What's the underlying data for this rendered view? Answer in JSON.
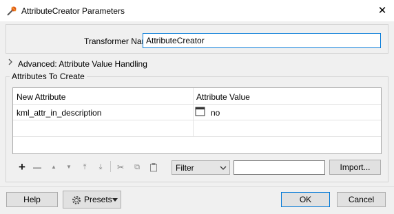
{
  "window": {
    "title": "AttributeCreator Parameters",
    "close_glyph": "✕",
    "icon": "attribute-creator-icon"
  },
  "form": {
    "transformer_name_label": "Transformer Name:",
    "transformer_name_value": "AttributeCreator",
    "advanced_label": "Advanced: Attribute Value Handling"
  },
  "attributes": {
    "group_label": "Attributes To Create",
    "columns": [
      "New Attribute",
      "Attribute Value"
    ],
    "rows": [
      {
        "name": "kml_attr_in_description",
        "value": "no",
        "value_icon": "text-editor-icon"
      }
    ]
  },
  "toolbar": {
    "add": "+",
    "remove": "—",
    "move_up": "▲",
    "move_down": "▼",
    "move_top": "⤒",
    "move_bottom": "⤓",
    "cut": "✂",
    "copy": "⧉",
    "paste": "📋",
    "filter_selected": "Filter",
    "filter_text": "",
    "import_label": "Import..."
  },
  "footer": {
    "help_label": "Help",
    "presets_label": "Presets",
    "ok_label": "OK",
    "cancel_label": "Cancel"
  },
  "colors": {
    "accent": "#0078d7",
    "background": "#f0f0f0",
    "button": "#e1e1e1"
  }
}
